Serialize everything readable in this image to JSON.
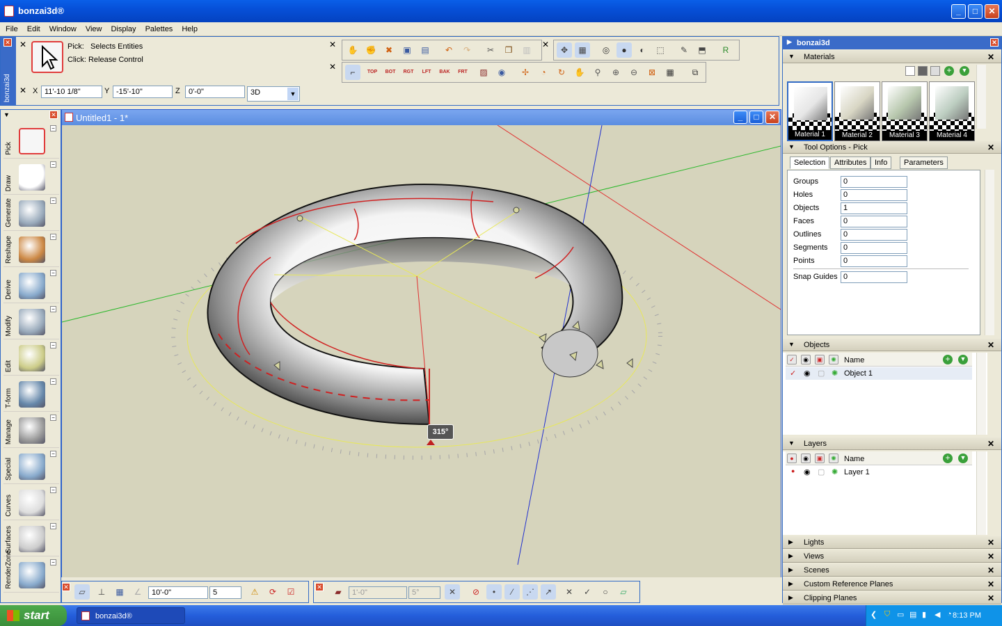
{
  "window": {
    "title": "bonzai3d®",
    "buttons": {
      "minimize": "_",
      "maximize": "□",
      "close": "✕"
    }
  },
  "menu": [
    "File",
    "Edit",
    "Window",
    "View",
    "Display",
    "Palettes",
    "Help"
  ],
  "side_tab_label": "bonzai3d",
  "pick_info": {
    "line1_label": "Pick:",
    "line1_value": "Selects Entities",
    "line2_label": "Click:",
    "line2_value": "Release Control"
  },
  "coords": {
    "x_label": "X",
    "x": "11'-10 1/8\"",
    "y_label": "Y",
    "y": "-15'-10\"",
    "z_label": "Z",
    "z": "0'-0\"",
    "mode": "3D"
  },
  "view_buttons": [
    "TOP",
    "BOT",
    "RGT",
    "LFT",
    "BAK",
    "FRT"
  ],
  "left_tools": [
    {
      "label": "Pick",
      "icon": "arrow-icon"
    },
    {
      "label": "Draw",
      "icon": "rectangle-icon"
    },
    {
      "label": "Generate",
      "icon": "torus-icon"
    },
    {
      "label": "Reshape",
      "icon": "reshape-icon"
    },
    {
      "label": "Derive",
      "icon": "derive-icon"
    },
    {
      "label": "Modify",
      "icon": "blob-icon"
    },
    {
      "label": "Edit",
      "icon": "edit-icon"
    },
    {
      "label": "T-form",
      "icon": "transform-icon"
    },
    {
      "label": "Manage",
      "icon": "trash-icon"
    },
    {
      "label": "Special",
      "icon": "special-icon"
    },
    {
      "label": "Curves",
      "icon": "curve-icon"
    },
    {
      "label": "Surfaces",
      "icon": "surface-icon"
    },
    {
      "label": "RenderZone",
      "icon": "render-icon"
    }
  ],
  "document": {
    "title": "Untitled1 - 1*",
    "angle_label": "315°"
  },
  "panel": {
    "title": "bonzai3d",
    "materials": {
      "title": "Materials",
      "items": [
        "Material 1",
        "Material 2",
        "Material 3",
        "Material 4"
      ],
      "colors": [
        "#e6e6e6",
        "#d8d6c4",
        "#b7c7ad",
        "#bccdc0"
      ]
    },
    "tool_options": {
      "title": "Tool Options - Pick",
      "tabs": [
        "Selection",
        "Attributes",
        "Info",
        "Parameters"
      ],
      "rows": [
        {
          "label": "Groups",
          "value": "0"
        },
        {
          "label": "Holes",
          "value": "0"
        },
        {
          "label": "Objects",
          "value": "1"
        },
        {
          "label": "Faces",
          "value": "0"
        },
        {
          "label": "Outlines",
          "value": "0"
        },
        {
          "label": "Segments",
          "value": "0"
        },
        {
          "label": "Points",
          "value": "0"
        }
      ],
      "snap": {
        "label": "Snap Guides",
        "value": "0"
      }
    },
    "objects": {
      "title": "Objects",
      "header": "Name",
      "rows": [
        "Object 1"
      ]
    },
    "layers": {
      "title": "Layers",
      "header": "Name",
      "rows": [
        "Layer 1"
      ]
    },
    "collapsed": [
      "Lights",
      "Views",
      "Scenes",
      "Custom Reference Planes",
      "Clipping Planes"
    ]
  },
  "bottom_toolbar": {
    "field1": "10'-0\"",
    "field2": "5",
    "field3": "1'-0\"",
    "field4": "5°"
  },
  "taskbar": {
    "start": "start",
    "item": "bonzai3d®",
    "time": "8:13 PM"
  }
}
